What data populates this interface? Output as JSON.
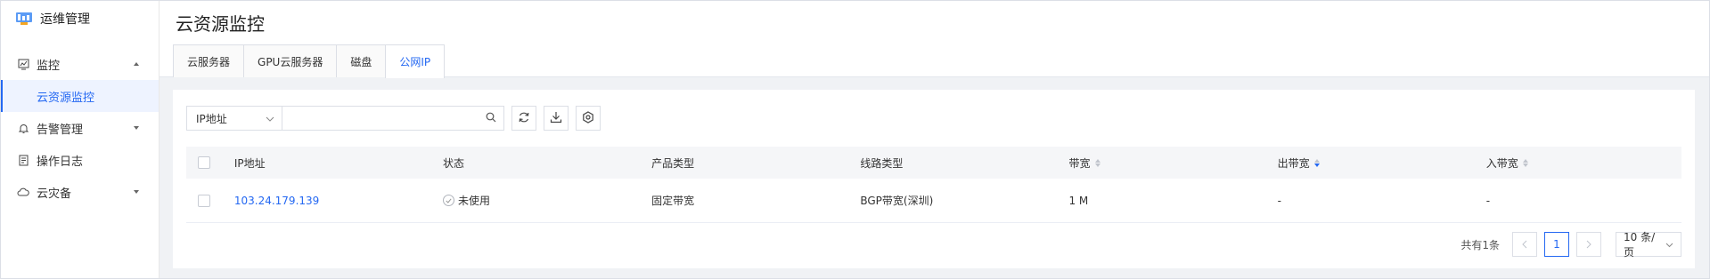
{
  "sidebar": {
    "brand": "运维管理",
    "items": [
      {
        "label": "监控",
        "icon": "monitor-icon"
      },
      {
        "label": "云资源监控",
        "icon": ""
      },
      {
        "label": "告警管理",
        "icon": "bell-icon"
      },
      {
        "label": "操作日志",
        "icon": "log-icon"
      },
      {
        "label": "云灾备",
        "icon": "cloud-icon"
      }
    ]
  },
  "header": {
    "title": "云资源监控",
    "tabs": [
      {
        "label": "云服务器"
      },
      {
        "label": "GPU云服务器"
      },
      {
        "label": "磁盘"
      },
      {
        "label": "公网IP"
      }
    ],
    "active_tab": "公网IP"
  },
  "toolbar": {
    "filter_select": "IP地址",
    "search_value": "",
    "search_placeholder": ""
  },
  "table": {
    "columns": [
      "IP地址",
      "状态",
      "产品类型",
      "线路类型",
      "带宽",
      "出带宽",
      "入带宽"
    ],
    "rows": [
      {
        "ip": "103.24.179.139",
        "status": "未使用",
        "product": "固定带宽",
        "line": "BGP带宽(深圳)",
        "bandwidth": "1 M",
        "out": "-",
        "in": "-"
      }
    ]
  },
  "pagination": {
    "total": "共有1条",
    "current": "1",
    "page_size": "10 条/页"
  },
  "colors": {
    "accent": "#2468f2",
    "bg": "#f0f2f5"
  }
}
